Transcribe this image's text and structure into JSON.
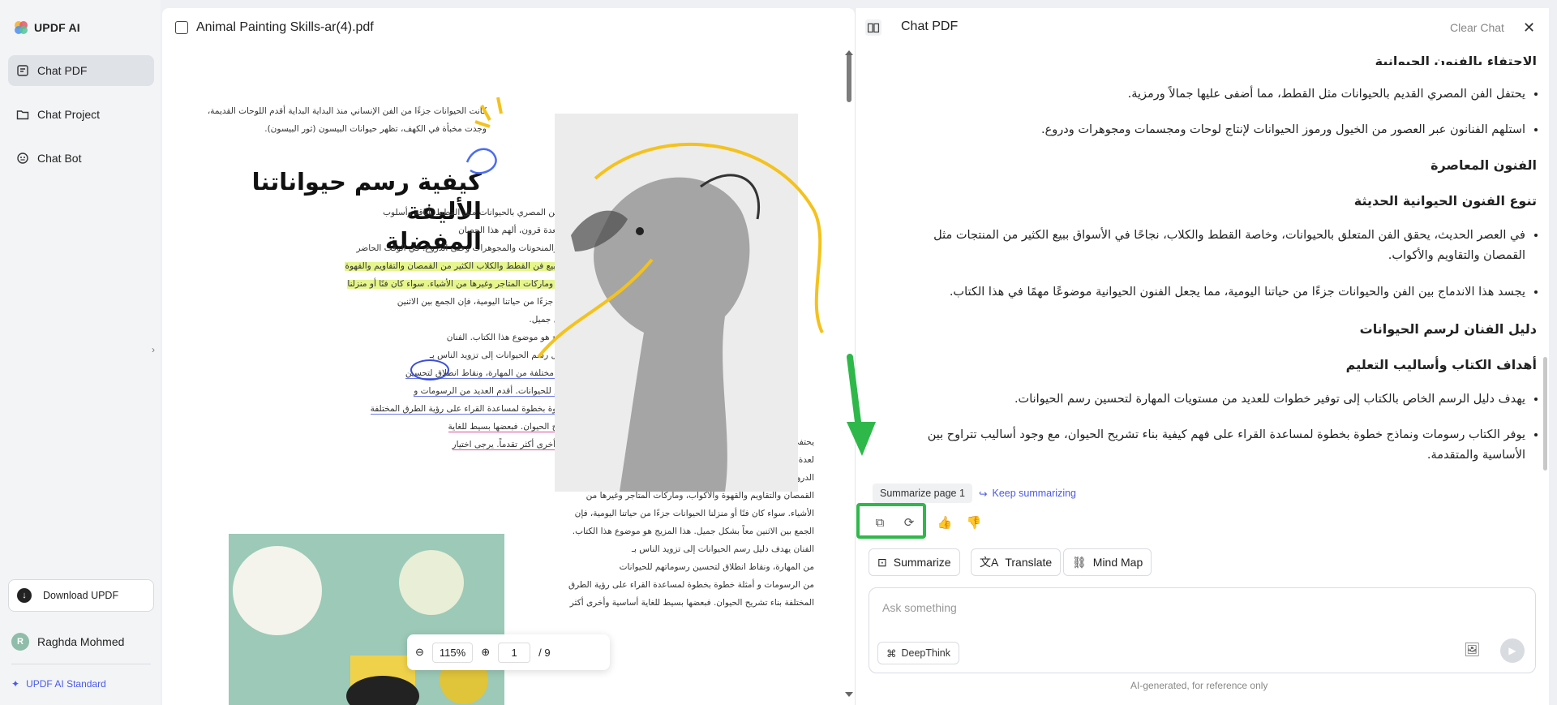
{
  "app": {
    "name": "UPDF AI"
  },
  "sidebar": {
    "items": [
      {
        "label": "Chat PDF",
        "icon": "chat-pdf-icon",
        "active": true
      },
      {
        "label": "Chat Project",
        "icon": "folder-icon",
        "active": false
      },
      {
        "label": "Chat Bot",
        "icon": "bot-icon",
        "active": false
      }
    ],
    "download_label": "Download UPDF",
    "user": {
      "initial": "R",
      "name": "Raghda Mohmed"
    },
    "plan_label": "UPDF AI Standard"
  },
  "pdf": {
    "filename": "Animal Painting Skills-ar(4).pdf",
    "zoom": "115%",
    "page_current": "1",
    "page_total": "/ 9",
    "page_text": {
      "intro_1": "كانت الحيوانات جزءًا من الفن الإنساني منذ البداية البداية أقدم اللوحات القديمة،",
      "intro_2": "وجدت مخبأة في الكهف، تظهر حيوانات البيسون (ثور البيسون).",
      "heading_1": "كيفية رسم حيواناتنا الأليفة",
      "heading_2": "المفضلة",
      "body": [
        "يحتفي الفن المصري بالحيوانات مثل القطط بأناقة وأسلوب",
        "الجمال. لعدة قرون، ألهم هذا الحصان",
        "اللوحات والمنحوتات والمجوهرات وحتى الدروع. في الوقت الحاضر",
        "العصور، يبيع فن القطط والكلاب الكثير من القمصان والتقاويم والقهوة",
        "والأكواب، وماركات المتاجر وغيرها من الأشياء. سواء كان فنًا أو منزلنا",
        "الحيوانات جزءًا من حياتنا اليومية، فإن الجمع بين الاثنين",
        "معاً بشكل جميل.",
        "هذا المزيج هو موضوع هذا الكتاب. الفنان",
        "يهدف دليل رسم الحيوانات إلى تزويد الناس بـ",
        "مستويات مختلفة من المهارة، ونقاط انطلاق لتحسين",
        "رسوماتهم للحيوانات. أقدم العديد من الرسومات و",
        "أمثلة خطوة بخطوة لمساعدة القراء على رؤية الطرق المختلفة",
        "بناء تشريح الحيوان. فبعضها بسيط للغاية",
        "أساسية وأخرى أكثر تقدماً. يرجى اختيار"
      ],
      "col2": [
        "يحتفي الفن المصري بالحيوانات مثل القطط بأناقة وأسلوب الجمال.",
        "لعدة قرون، ألهم هذا الحصان اللوحات والمنحوتات والمجوهرات وحتى",
        "الدروع. في الوقت الحاضر العصور، يبيع فن القطط والكلاب الكثير من",
        "القمصان والتقاويم والقهوة والأكواب، وماركات المتاجر وغيرها من",
        "الأشياء. سواء كان فنًا أو منزلنا الحيوانات جزءًا من حياتنا اليومية، فإن",
        "الجمع بين الاثنين معاً بشكل جميل. هذا المزيج هو موضوع هذا الكتاب.",
        "الفنان يهدف دليل رسم الحيوانات إلى تزويد الناس بـ",
        "من المهارة، ونقاط انطلاق لتحسين رسوماتهم للحيوانات",
        "من الرسومات و أمثلة خطوة بخطوة لمساعدة القراء على رؤية الطرق",
        "المختلفة بناء تشريح الحيوان. فبعضها بسيط للغاية أساسية وأخرى أكثر"
      ]
    }
  },
  "chat": {
    "title": "Chat PDF",
    "clear_label": "Clear Chat",
    "messages": {
      "partial_heading": "الاحتفاء بالفنون الحيوانية",
      "b1": "يحتفل الفن المصري القديم بالحيوانات مثل القطط، مما أضفى عليها جمالاً ورمزية.",
      "b2": "استلهم الفنانون عبر العصور من الخيول ورموز الحيوانات لإنتاج لوحات ومجسمات ومجوهرات ودروع.",
      "h_contemporary": "الفنون المعاصرة",
      "h_variety": "تنوع الفنون الحيوانية الحديثة",
      "b3": "في العصر الحديث، يحقق الفن المتعلق بالحيوانات، وخاصة القطط والكلاب، نجاحًا في الأسواق ببيع الكثير من المنتجات مثل القمصان والتقاويم والأكواب.",
      "b4": "يجسد هذا الاندماج بين الفن والحيوانات جزءًا من حياتنا اليومية، مما يجعل الفنون الحيوانية موضوعًا مهمًا في هذا الكتاب.",
      "h_guide": "دليل الفنان لرسم الحيوانات",
      "h_goals": "أهداف الكتاب وأساليب التعليم",
      "b5": "يهدف دليل الرسم الخاص بالكتاب إلى توفير خطوات للعديد من مستويات المهارة لتحسين رسم الحيوانات.",
      "b6": "يوفر الكتاب رسومات ونماذج خطوة بخطوة لمساعدة القراء على فهم كيفية بناء تشريح الحيوان، مع وجود أساليب تتراوح بين الأساسية والمتقدمة."
    },
    "summarize_page_label": "Summarize page 1",
    "keep_summarizing_label": "Keep summarizing",
    "actions": [
      "Summarize",
      "Translate",
      "Mind Map"
    ],
    "input_placeholder": "Ask something",
    "deepthink_label": "DeepThink",
    "footer_note": "AI-generated, for reference only"
  },
  "colors": {
    "accent": "#4a5ae8",
    "highlight_box": "#2fb84a",
    "arrow": "#2fb84a",
    "active_nav": "#dfe2e7"
  }
}
